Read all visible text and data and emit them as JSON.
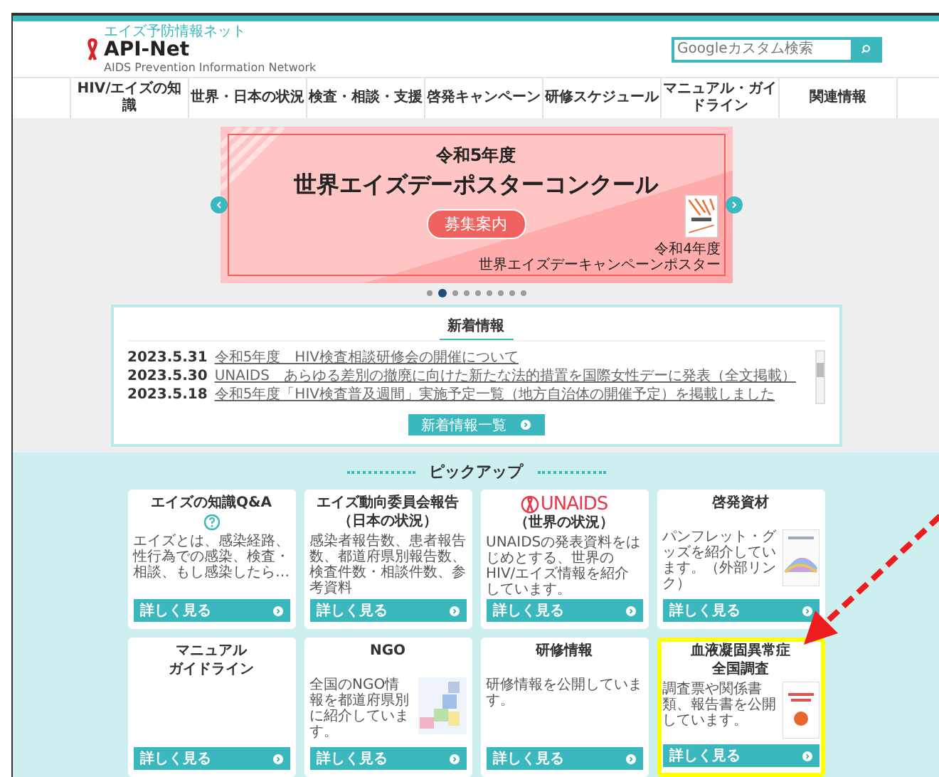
{
  "header": {
    "logo_caption": "エイズ予防情報ネット",
    "logo_title": "API-Net",
    "logo_subtitle": "AIDS Prevention Information Network",
    "search": {
      "placeholder": "Googleカスタム検索"
    }
  },
  "nav": [
    "HIV/エイズの知識",
    "世界・日本の状況",
    "検査・相談・支援",
    "啓発キャンペーン",
    "研修スケジュール",
    "マニュアル・ガイドライン",
    "関連情報"
  ],
  "banner": {
    "year": "令和5年度",
    "title": "世界エイズデーポスターコンクール",
    "button": "募集案内",
    "poster_caption_lines": [
      "令和4年度",
      "世界エイズデーキャンペーンポスター"
    ],
    "dots": [
      {
        "selected": false
      },
      {
        "selected": true
      },
      {
        "selected": false
      },
      {
        "selected": false
      },
      {
        "selected": false
      },
      {
        "selected": false
      },
      {
        "selected": false
      },
      {
        "selected": false
      },
      {
        "selected": false
      }
    ]
  },
  "news": {
    "title": "新着情報",
    "items": [
      {
        "date": "2023.5.31",
        "text": "令和5年度　HIV検査相談研修会の開催について"
      },
      {
        "date": "2023.5.30",
        "text": "UNAIDS　あらゆる差別の撤廃に向けた新たな法的措置を国際女性デーに発表（全文掲載）"
      },
      {
        "date": "2023.5.18",
        "text": "令和5年度「HIV検査普及週間」実施予定一覧（地方自治体の開催予定）を掲載しました"
      }
    ],
    "button": "新着情報一覧"
  },
  "pickup": {
    "title": "ピックアップ",
    "cards": [
      {
        "kind": "question",
        "title_lines": [
          "エイズの知識Q&A"
        ],
        "text": "エイズとは、感染経路、性行為での感染、検査・相談、もし感染したら…",
        "button": "詳しく見る",
        "highlighted": false
      },
      {
        "kind": "plain",
        "title_lines": [
          "エイズ動向委員会報告",
          "（日本の状況）"
        ],
        "text": "感染者報告数、患者報告数、都道府県別報告数、検査件数・相談件数、参考資料",
        "button": "詳しく見る",
        "highlighted": false
      },
      {
        "kind": "unaids",
        "title_lines": [
          "UNAIDS",
          "（世界の状況）"
        ],
        "text": "UNAIDSの発表資料をはじめとする、世界のHIV/エイズ情報を紹介しています。",
        "button": "詳しく見る",
        "highlighted": false
      },
      {
        "kind": "thumb",
        "title_lines": [
          "啓発資材"
        ],
        "text": "パンフレット・グッズを紹介しています。（外部リンク）",
        "button": "詳しく見る",
        "highlighted": false
      },
      {
        "kind": "plain",
        "title_lines": [
          "マニュアル",
          "ガイドライン"
        ],
        "button": "詳しく見る",
        "highlighted": false
      },
      {
        "kind": "map",
        "title_lines": [
          "NGO"
        ],
        "text": "全国のNGO情報を都道府県別に紹介しています。",
        "button": "詳しく見る",
        "highlighted": false
      },
      {
        "kind": "plain",
        "title_lines": [
          "研修情報"
        ],
        "text": "研修情報を公開しています。",
        "button": "詳しく見る",
        "highlighted": false
      },
      {
        "kind": "report",
        "title_lines": [
          "血液凝固異常症",
          "全国調査"
        ],
        "text": "調査票や関係書類、報告書を公開しています。",
        "button": "詳しく見る",
        "highlighted": true
      }
    ]
  }
}
